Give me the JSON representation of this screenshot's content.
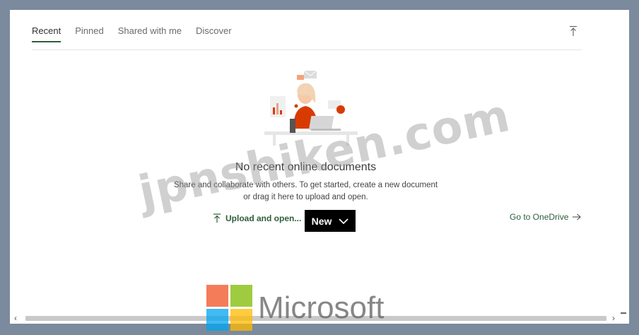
{
  "tabs": [
    {
      "label": "Recent",
      "active": true
    },
    {
      "label": "Pinned",
      "active": false
    },
    {
      "label": "Shared with me",
      "active": false
    },
    {
      "label": "Discover",
      "active": false
    }
  ],
  "icons": {
    "collapse": "upload-arrow-icon",
    "upload": "upload-arrow-icon",
    "new_chevron": "chevron-down-icon",
    "onedrive_arrow": "arrow-right-icon",
    "scroll_left": "chevron-left-icon",
    "scroll_right": "chevron-right-icon"
  },
  "empty_state": {
    "title": "No recent online documents",
    "desc_line1": "Share and collaborate with others. To get started, create a new document",
    "desc_line2": "or drag it here to upload and open."
  },
  "actions": {
    "upload_label": "Upload and open...",
    "new_label": "New",
    "onedrive_label": "Go to OneDrive"
  },
  "scroll": {
    "left": "‹",
    "right": "›"
  },
  "watermark": "jpnshiken.com",
  "brand": {
    "name": "Microsoft",
    "colors": [
      "#f25022",
      "#7fba00",
      "#00a4ef",
      "#ffb900"
    ]
  },
  "colors": {
    "accent": "#2f5d3a",
    "illustration": "#d83b01"
  }
}
